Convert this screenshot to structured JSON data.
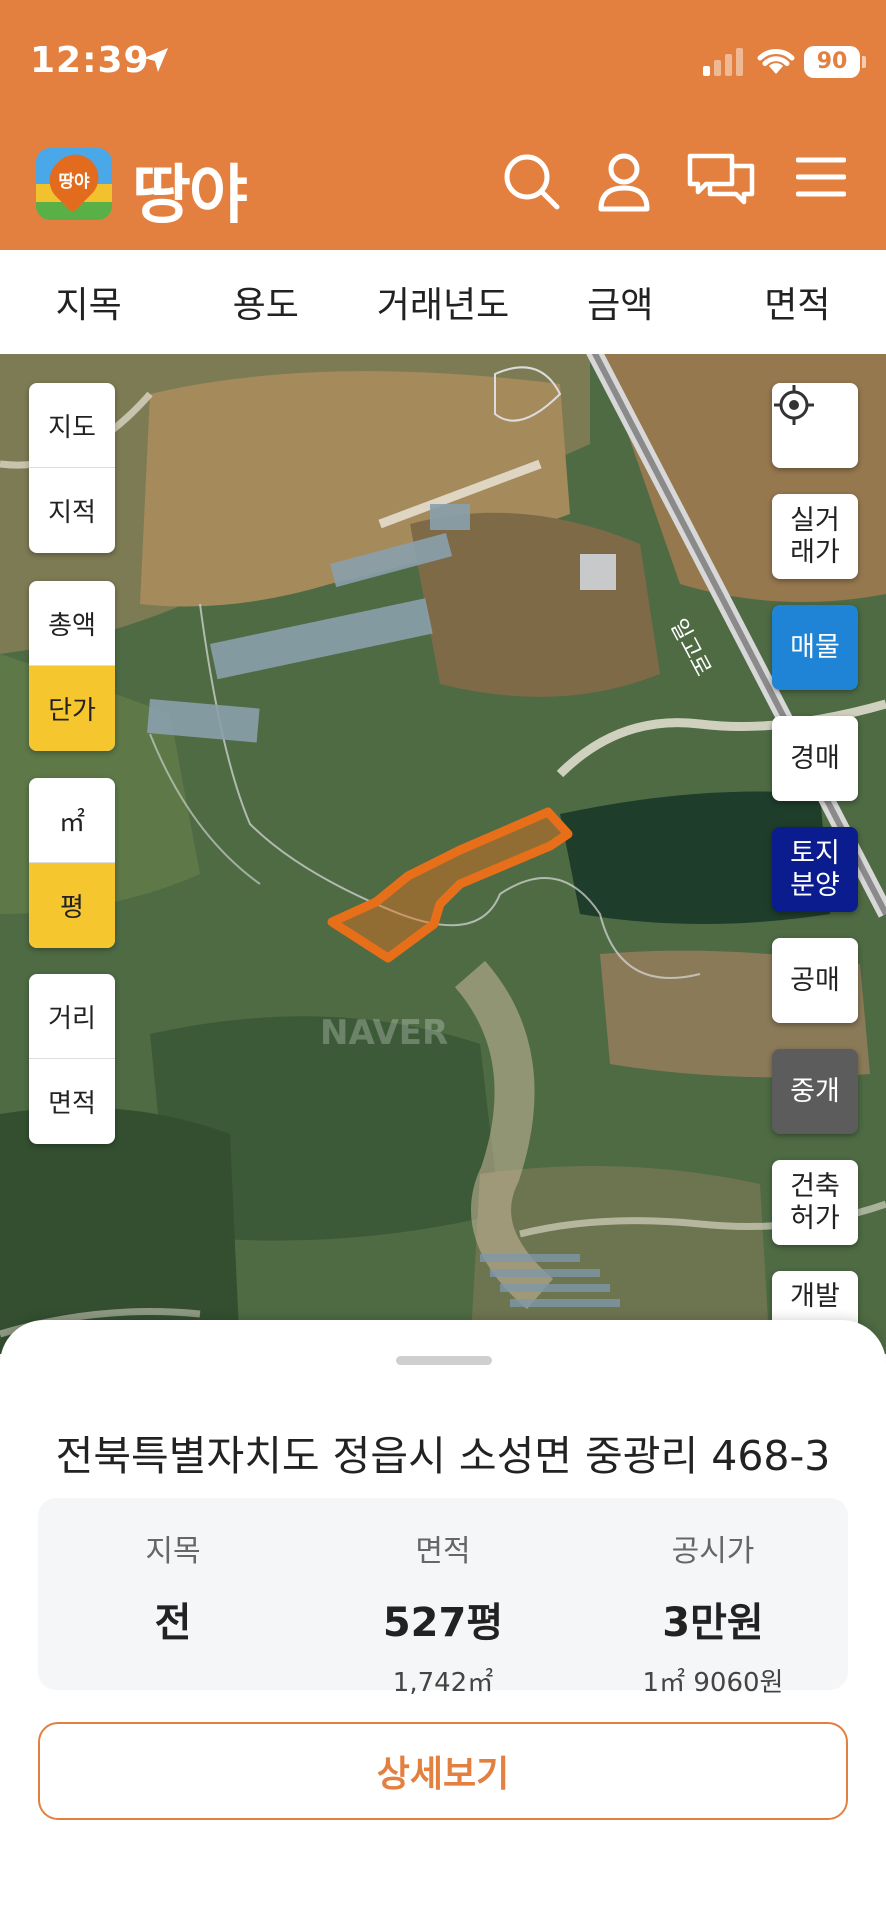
{
  "status_bar": {
    "time": "12:39",
    "battery": "90"
  },
  "header": {
    "brand": "땅야",
    "logo_text": "땅야",
    "icons": [
      "search-icon",
      "user-icon",
      "chat-icon",
      "menu-icon"
    ]
  },
  "filters": [
    "지목",
    "용도",
    "거래년도",
    "금액",
    "면적"
  ],
  "map": {
    "left_groups": [
      [
        {
          "label": "지도",
          "active": false
        },
        {
          "label": "지적",
          "active": false
        }
      ],
      [
        {
          "label": "총액",
          "active": false
        },
        {
          "label": "단가",
          "active": true
        }
      ],
      [
        {
          "label": "㎡",
          "active": false
        },
        {
          "label": "평",
          "active": true
        }
      ],
      [
        {
          "label": "거리",
          "active": false
        },
        {
          "label": "면적",
          "active": false
        }
      ]
    ],
    "right_buttons": [
      {
        "label": "",
        "icon": "crosshair-icon",
        "style": "white"
      },
      {
        "label": "실거\n래가",
        "style": "white"
      },
      {
        "label": "매물",
        "style": "blue"
      },
      {
        "label": "경매",
        "style": "white"
      },
      {
        "label": "토지\n분양",
        "style": "navy"
      },
      {
        "label": "공매",
        "style": "white"
      },
      {
        "label": "중개",
        "style": "gray"
      },
      {
        "label": "건축\n허가",
        "style": "white"
      },
      {
        "label": "개발",
        "style": "white"
      }
    ],
    "road_label": "일고로",
    "watermark": "NAVER"
  },
  "sheet": {
    "address": "전북특별자치도 정읍시 소성면 중광리 468-3",
    "land_type": {
      "label": "지목",
      "value": "전"
    },
    "area": {
      "label": "면적",
      "value": "527평",
      "sub": "1,742㎡"
    },
    "price": {
      "label": "공시가",
      "value": "3만원",
      "sub": "1㎡ 9060원"
    },
    "detail_button": "상세보기"
  },
  "colors": {
    "brand": "#e3803f",
    "active_yellow": "#f6c62f",
    "blue": "#1f84d6",
    "navy": "#0b1c8f",
    "gray": "#5c5c5c"
  }
}
